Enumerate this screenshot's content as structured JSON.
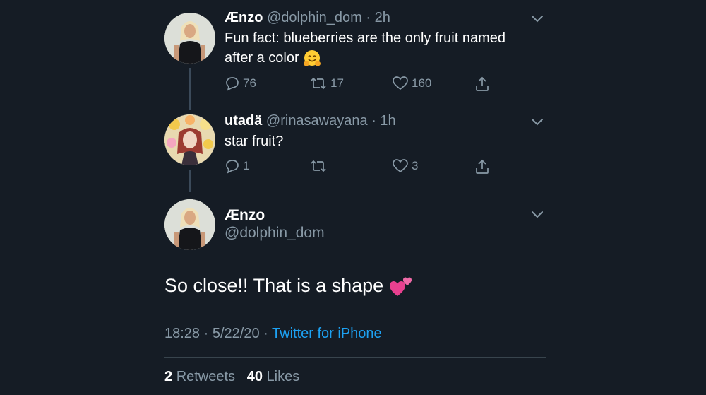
{
  "tweets": [
    {
      "name": "Ænzo",
      "handle": "@dolphin_dom",
      "sep": "·",
      "time": "2h",
      "text_line1": "Fun fact: blueberries are the only fruit named",
      "text_line2": "after a color",
      "emoji": "hugging-face",
      "replies": "76",
      "retweets": "17",
      "likes": "160"
    },
    {
      "name": "utadä",
      "handle": "@rinasawayana",
      "sep": "·",
      "time": "1h",
      "text": "star fruit?",
      "replies": "1",
      "retweets": "",
      "likes": "3"
    }
  ],
  "main": {
    "name": "Ænzo",
    "handle": "@dolphin_dom",
    "text": "So close!! That is a shape",
    "emoji": "two-hearts",
    "time": "18:28",
    "date": "5/22/20",
    "sep": "·",
    "source": "Twitter for iPhone",
    "retweet_count": "2",
    "retweet_label": "Retweets",
    "like_count": "40",
    "like_label": "Likes"
  },
  "colors": {
    "background": "#151c25",
    "secondary_text": "#8899a6",
    "link": "#1da1f2",
    "divider": "#38444d"
  }
}
